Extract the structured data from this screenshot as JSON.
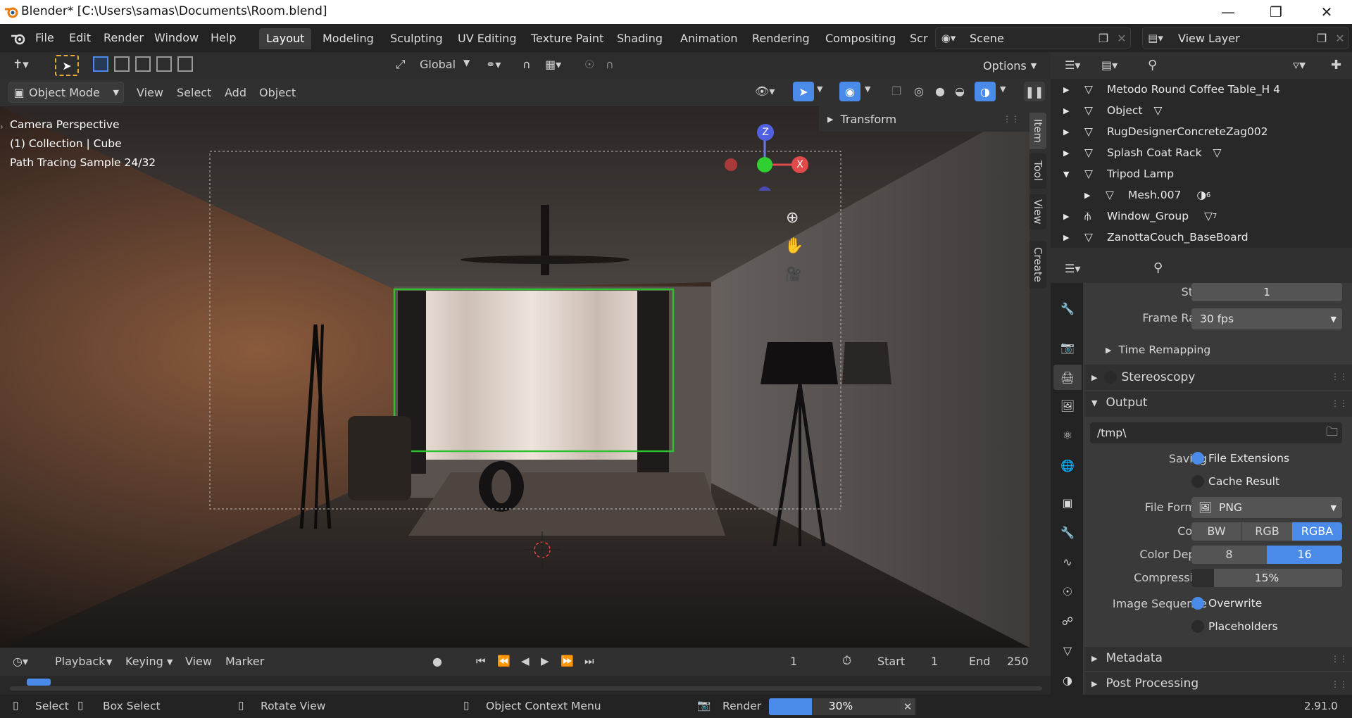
{
  "window": {
    "title": "Blender* [C:\\Users\\samas\\Documents\\Room.blend]"
  },
  "menu": [
    "File",
    "Edit",
    "Render",
    "Window",
    "Help"
  ],
  "workspaces": [
    "Layout",
    "Modeling",
    "Sculpting",
    "UV Editing",
    "Texture Paint",
    "Shading",
    "Animation",
    "Rendering",
    "Compositing",
    "Scr"
  ],
  "scene": {
    "name": "Scene",
    "view_layer": "View Layer"
  },
  "toolbar": {
    "transform_orientation": "Global",
    "options": "Options"
  },
  "viewport_header": {
    "mode": "Object Mode",
    "menus": [
      "View",
      "Select",
      "Add",
      "Object"
    ]
  },
  "overlay": {
    "line1": "Camera Perspective",
    "line2": "(1) Collection | Cube",
    "line3": "Path Tracing Sample 24/32"
  },
  "gizmo": {
    "z": "Z",
    "x": "X"
  },
  "sidebar": {
    "panel": "Transform",
    "tabs": [
      "Item",
      "Tool",
      "View",
      "Create"
    ]
  },
  "outliner": {
    "items": [
      {
        "name": "Metodo Round Coffee Table_H 4",
        "expanded": false
      },
      {
        "name": "Object",
        "expanded": false
      },
      {
        "name": "RugDesignerConcreteZag002",
        "expanded": false
      },
      {
        "name": "Splash Coat Rack",
        "expanded": false
      },
      {
        "name": "Tripod Lamp",
        "expanded": true
      },
      {
        "name": "Mesh.007",
        "child": true,
        "badge": "6"
      },
      {
        "name": "Window_Group",
        "expanded": false,
        "badge": "7"
      },
      {
        "name": "ZanottaCouch_BaseBoard",
        "expanded": false
      }
    ]
  },
  "properties": {
    "step_label": "Step",
    "step_value": "1",
    "frame_rate_label": "Frame Rate",
    "frame_rate_value": "30 fps",
    "time_remapping": "Time Remapping",
    "stereoscopy": "Stereoscopy",
    "output": "Output",
    "path": "/tmp\\",
    "saving_label": "Saving",
    "file_extensions": "File Extensions",
    "cache_result": "Cache Result",
    "file_format_label": "File Format",
    "file_format_value": "PNG",
    "color_label": "Color",
    "color_options": [
      "BW",
      "RGB",
      "RGBA"
    ],
    "color_depth_label": "Color Depth",
    "color_depth_options": [
      "8",
      "16"
    ],
    "compression_label": "Compression",
    "compression_value": "15%",
    "image_sequence_label": "Image Sequence",
    "overwrite": "Overwrite",
    "placeholders": "Placeholders",
    "metadata": "Metadata",
    "post_processing": "Post Processing"
  },
  "timeline": {
    "menus": [
      "Playback",
      "Keying",
      "View",
      "Marker"
    ],
    "current_frame": "1",
    "start_label": "Start",
    "start": "1",
    "end_label": "End",
    "end": "250"
  },
  "statusbar": {
    "select": "Select",
    "box_select": "Box Select",
    "rotate_view": "Rotate View",
    "context_menu": "Object Context Menu",
    "render": "Render",
    "progress_text": "30%",
    "progress": 0.3,
    "version": "2.91.0"
  },
  "colors": {
    "accent": "#4a8ae8",
    "selection": "#2fc02f",
    "bg": "#303030"
  }
}
